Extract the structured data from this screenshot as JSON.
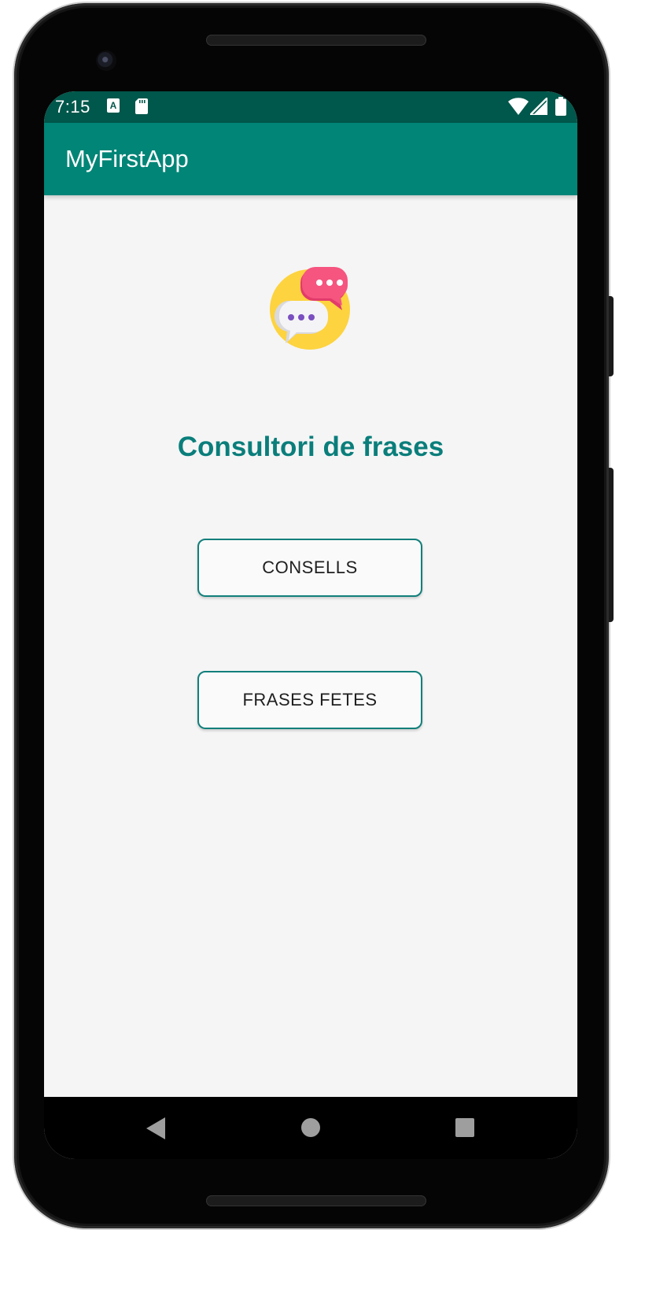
{
  "status_bar": {
    "time": "7:15",
    "icons": [
      "keyboard-a-icon",
      "sd-card-icon",
      "wifi-icon",
      "cellular-signal-icon",
      "battery-icon"
    ]
  },
  "app_bar": {
    "title": "MyFirstApp"
  },
  "main": {
    "logo_icon": "chat-bubbles-icon",
    "heading": "Consultori de frases",
    "buttons": [
      {
        "label": "CONSELLS"
      },
      {
        "label": "FRASES FETES"
      }
    ]
  },
  "nav_bar": {
    "icons": [
      "back-icon",
      "home-icon",
      "recents-icon"
    ]
  },
  "colors": {
    "status_bar": "#00574b",
    "app_bar": "#008577",
    "heading": "#0a7e7b",
    "button_border": "#117f7b",
    "background": "#f5f5f5"
  }
}
